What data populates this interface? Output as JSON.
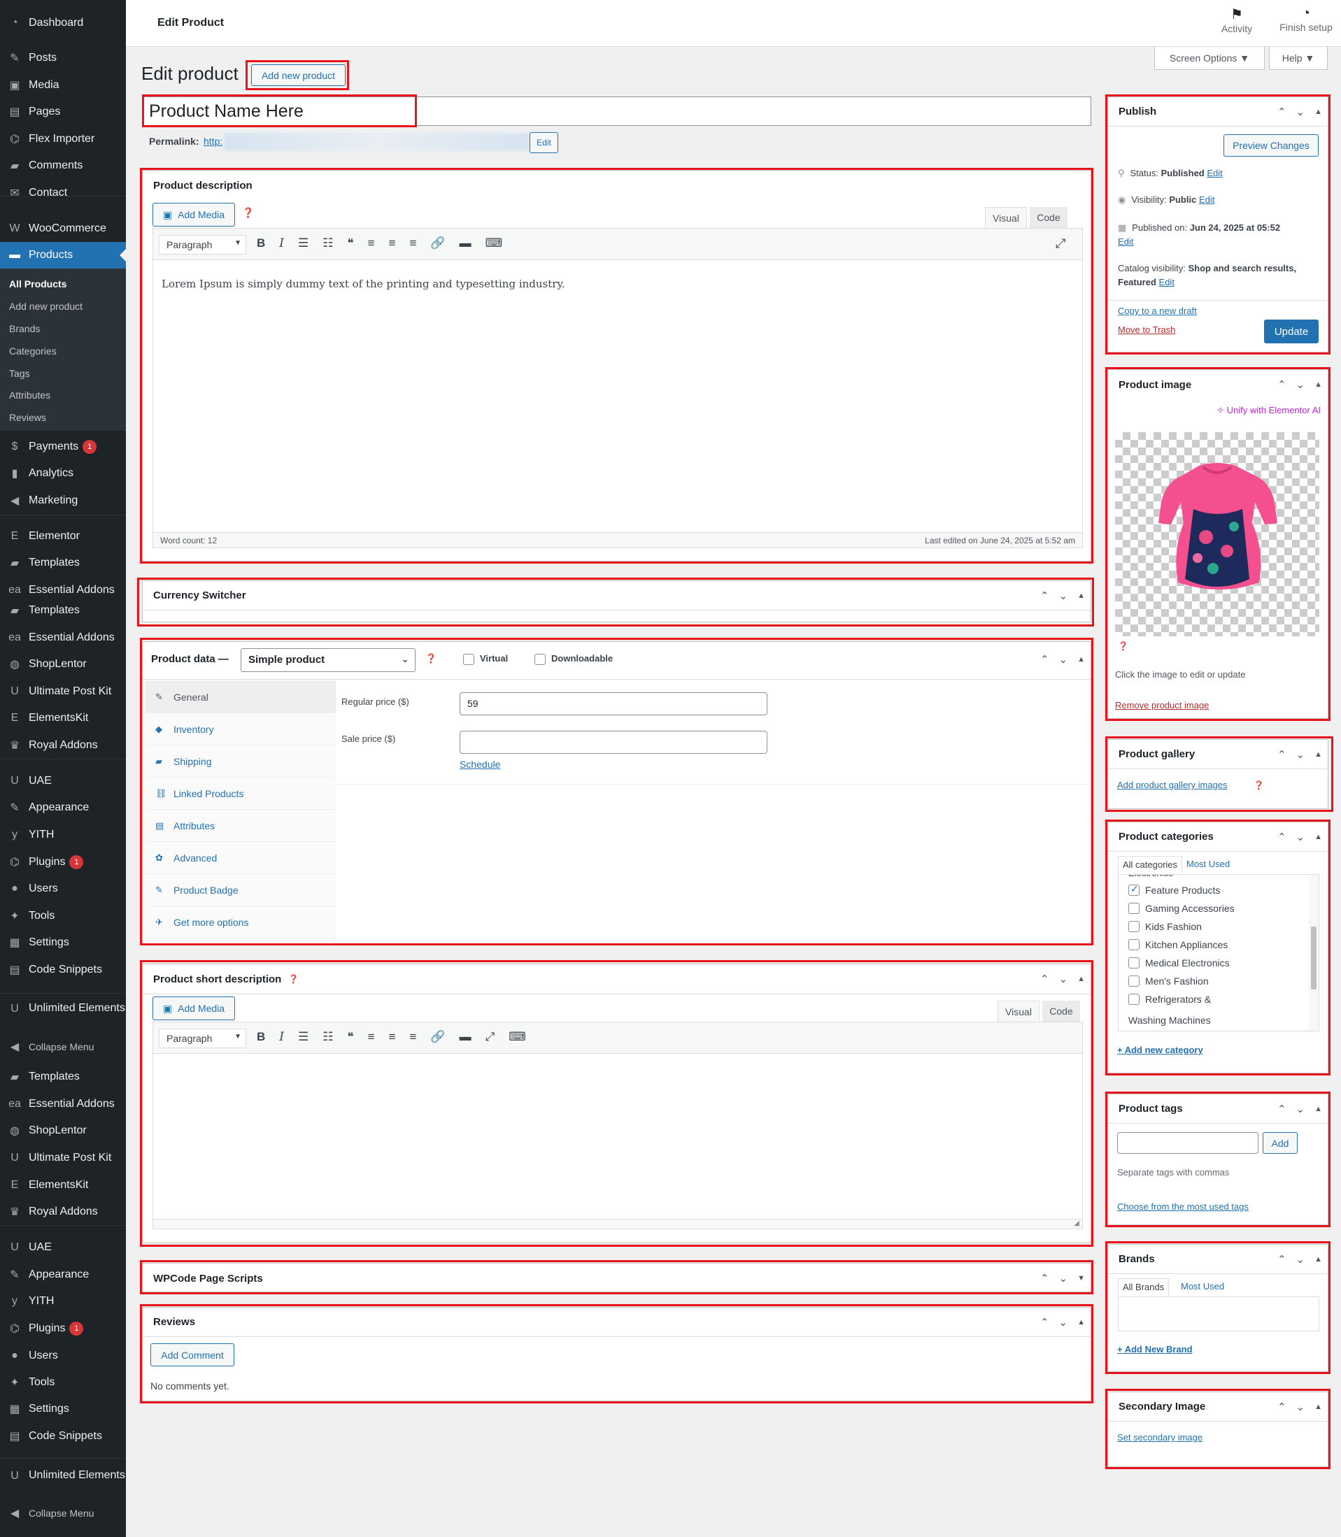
{
  "sidebar": {
    "items": [
      {
        "label": "Dashboard",
        "icon": "dashboard-icon",
        "glyph": "◔"
      },
      {
        "label": "Posts",
        "icon": "pin-icon",
        "glyph": "✎"
      },
      {
        "label": "Media",
        "icon": "media-icon",
        "glyph": "▣"
      },
      {
        "label": "Pages",
        "icon": "pages-icon",
        "glyph": "▤"
      },
      {
        "label": "Flex Importer",
        "icon": "plug-icon",
        "glyph": "⌬"
      },
      {
        "label": "Comments",
        "icon": "comment-icon",
        "glyph": "▰"
      },
      {
        "label": "Contact",
        "icon": "mail-icon",
        "glyph": "✉"
      },
      {
        "label": "WooCommerce",
        "icon": "woo-icon",
        "glyph": "W"
      },
      {
        "label": "Products",
        "icon": "products-icon",
        "glyph": "▬"
      }
    ],
    "products_sub": [
      "All Products",
      "Add new product",
      "Brands",
      "Categories",
      "Tags",
      "Attributes",
      "Reviews"
    ],
    "items2": [
      {
        "label": "Payments",
        "badge": "1",
        "icon": "payments-icon",
        "glyph": "$"
      },
      {
        "label": "Analytics",
        "icon": "analytics-icon",
        "glyph": "▮"
      },
      {
        "label": "Marketing",
        "icon": "megaphone-icon",
        "glyph": "◀"
      },
      {
        "label": "Elementor",
        "icon": "elementor-icon",
        "glyph": "E"
      },
      {
        "label": "Templates",
        "icon": "folder-icon",
        "glyph": "▰"
      },
      {
        "label": "Essential Addons",
        "icon": "ea-icon",
        "glyph": "ea"
      },
      {
        "label": "Templates",
        "icon": "folder-icon",
        "glyph": "▰"
      },
      {
        "label": "Essential Addons",
        "icon": "ea-icon",
        "glyph": "ea"
      },
      {
        "label": "ShopLentor",
        "icon": "shoplentor-icon",
        "glyph": "◍"
      },
      {
        "label": "Ultimate Post Kit",
        "icon": "upk-icon",
        "glyph": "U"
      },
      {
        "label": "ElementsKit",
        "icon": "elementskit-icon",
        "glyph": "E"
      },
      {
        "label": "Royal Addons",
        "icon": "crown-icon",
        "glyph": "♛"
      },
      {
        "label": "UAE",
        "icon": "uae-icon",
        "glyph": "U"
      },
      {
        "label": "Appearance",
        "icon": "brush-icon",
        "glyph": "✎"
      },
      {
        "label": "YITH",
        "icon": "yith-icon",
        "glyph": "y"
      },
      {
        "label": "Plugins",
        "badge": "1",
        "icon": "plugin-icon",
        "glyph": "⌬"
      },
      {
        "label": "Users",
        "icon": "user-icon",
        "glyph": "●"
      },
      {
        "label": "Tools",
        "icon": "wrench-icon",
        "glyph": "✦"
      },
      {
        "label": "Settings",
        "icon": "settings-icon",
        "glyph": "▦"
      },
      {
        "label": "Code Snippets",
        "icon": "code-icon",
        "glyph": "▤"
      },
      {
        "label": "Unlimited Elements",
        "icon": "unlimited-icon",
        "glyph": "U"
      },
      {
        "label": "Collapse Menu",
        "icon": "collapse-icon",
        "glyph": "◀"
      },
      {
        "label": "Templates",
        "icon": "folder-icon",
        "glyph": "▰"
      },
      {
        "label": "Essential Addons",
        "icon": "ea-icon",
        "glyph": "ea"
      },
      {
        "label": "ShopLentor",
        "icon": "shoplentor-icon",
        "glyph": "◍"
      },
      {
        "label": "Ultimate Post Kit",
        "icon": "upk-icon",
        "glyph": "U"
      },
      {
        "label": "ElementsKit",
        "icon": "elementskit-icon",
        "glyph": "E"
      },
      {
        "label": "Royal Addons",
        "icon": "crown-icon",
        "glyph": "♛"
      },
      {
        "label": "UAE",
        "icon": "uae-icon",
        "glyph": "U"
      },
      {
        "label": "Appearance",
        "icon": "brush-icon",
        "glyph": "✎"
      },
      {
        "label": "YITH",
        "icon": "yith-icon",
        "glyph": "y"
      },
      {
        "label": "Plugins",
        "badge": "1",
        "icon": "plugin-icon",
        "glyph": "⌬"
      },
      {
        "label": "Users",
        "icon": "user-icon",
        "glyph": "●"
      },
      {
        "label": "Tools",
        "icon": "wrench-icon",
        "glyph": "✦"
      },
      {
        "label": "Settings",
        "icon": "settings-icon",
        "glyph": "▦"
      },
      {
        "label": "Code Snippets",
        "icon": "code-icon",
        "glyph": "▤"
      },
      {
        "label": "Unlimited Elements",
        "icon": "unlimited-icon",
        "glyph": "U"
      },
      {
        "label": "Collapse Menu",
        "icon": "collapse-icon",
        "glyph": "◀"
      }
    ]
  },
  "topbar": {
    "title": "Edit Product",
    "activity": "Activity",
    "finish_setup": "Finish setup"
  },
  "screen_options": "Screen Options ▼",
  "help": "Help ▼",
  "heading": {
    "title": "Edit product",
    "add_new": "Add new product"
  },
  "title_field": "Product Name Here",
  "permalink": {
    "label": "Permalink:",
    "url": "http:",
    "edit": "Edit"
  },
  "description": {
    "title": "Product description",
    "add_media": "Add Media",
    "visual": "Visual",
    "code": "Code",
    "format": "Paragraph",
    "content": "Lorem Ipsum is simply dummy text of the printing and typesetting industry.",
    "word_count": "Word count: 12",
    "last_edited": "Last edited on June 24, 2025 at 5:52 am"
  },
  "currency_switcher": {
    "title": "Currency Switcher"
  },
  "product_data": {
    "title": "Product data —",
    "type": "Simple product",
    "virtual": "Virtual",
    "downloadable": "Downloadable",
    "tabs": [
      {
        "label": "General",
        "glyph": "✎",
        "icon": "wrench-icon"
      },
      {
        "label": "Inventory",
        "glyph": "◆",
        "icon": "tag-icon"
      },
      {
        "label": "Shipping",
        "glyph": "▰",
        "icon": "truck-icon"
      },
      {
        "label": "Linked Products",
        "glyph": "⛓",
        "icon": "link-icon"
      },
      {
        "label": "Attributes",
        "glyph": "▤",
        "icon": "list-icon"
      },
      {
        "label": "Advanced",
        "glyph": "✿",
        "icon": "gear-icon"
      },
      {
        "label": "Product Badge",
        "glyph": "✎",
        "icon": "badge-icon"
      },
      {
        "label": "Get more options",
        "glyph": "✈",
        "icon": "plugin-icon"
      }
    ],
    "regular_price_label": "Regular price ($)",
    "regular_price": "59",
    "sale_price_label": "Sale price ($)",
    "sale_price": "",
    "schedule": "Schedule"
  },
  "short_description": {
    "title": "Product short description",
    "add_media": "Add Media",
    "visual": "Visual",
    "code": "Code",
    "format": "Paragraph"
  },
  "wpcode": {
    "title": "WPCode Page Scripts"
  },
  "reviews": {
    "title": "Reviews",
    "add_comment": "Add Comment",
    "empty": "No comments yet."
  },
  "publish": {
    "title": "Publish",
    "preview": "Preview Changes",
    "status_label": "Status:",
    "status": "Published",
    "edit": "Edit",
    "visibility_label": "Visibility:",
    "visibility": "Public",
    "published_label": "Published on:",
    "published_on": "Jun 24, 2025 at 05:52",
    "catalog_label": "Catalog visibility:",
    "catalog": "Shop and search results, Featured",
    "copy_draft": "Copy to a new draft",
    "trash": "Move to Trash",
    "update": "Update"
  },
  "product_image": {
    "title": "Product image",
    "unify": "Unify with Elementor AI",
    "click_hint": "Click the image to edit or update",
    "remove": "Remove product image"
  },
  "gallery": {
    "title": "Product gallery",
    "add": "Add product gallery images"
  },
  "categories": {
    "title": "Product categories",
    "tab_all": "All categories",
    "tab_used": "Most Used",
    "items": [
      {
        "label": "Feature Products",
        "checked": true
      },
      {
        "label": "Gaming Accessories",
        "checked": false
      },
      {
        "label": "Kids Fashion",
        "checked": false
      },
      {
        "label": "Kitchen Appliances",
        "checked": false
      },
      {
        "label": "Medical Electronics",
        "checked": false
      },
      {
        "label": "Men's Fashion",
        "checked": false
      },
      {
        "label": "Refrigerators &",
        "checked": false
      }
    ],
    "wrap_line": "Washing Machines",
    "add_new": "+ Add new category"
  },
  "tags": {
    "title": "Product tags",
    "add": "Add",
    "hint": "Separate tags with commas",
    "choose": "Choose from the most used tags"
  },
  "brands": {
    "title": "Brands",
    "tab_all": "All Brands",
    "tab_used": "Most Used",
    "add_new": "+ Add New Brand"
  },
  "secondary_image": {
    "title": "Secondary Image",
    "set": "Set secondary image"
  },
  "colors": {
    "admin_bg": "#1d2327",
    "accent": "#2271b1",
    "highlight_border": "#e8141b",
    "link_danger": "#b32d2e"
  }
}
